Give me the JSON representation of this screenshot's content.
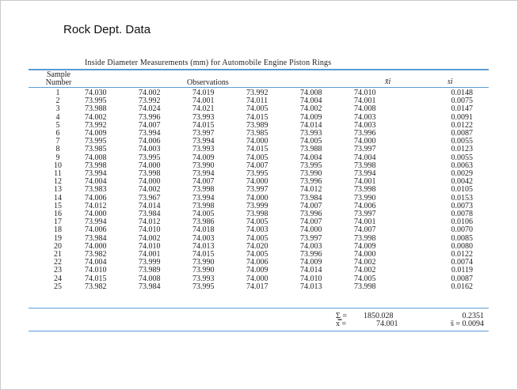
{
  "doc_title": "Rock Dept. Data",
  "caption": "Inside Diameter Measurements (mm) for Automobile Engine Piston Rings",
  "headers": {
    "sample_line1": "Sample",
    "sample_line2": "Number",
    "observations": "Observations",
    "xbar": "x̄i",
    "s": "si"
  },
  "rows": [
    [
      "1",
      "74.030",
      "74.002",
      "74.019",
      "73.992",
      "74.008",
      "74.010",
      "0.0148"
    ],
    [
      "2",
      "73.995",
      "73.992",
      "74.001",
      "74.011",
      "74.004",
      "74.001",
      "0.0075"
    ],
    [
      "3",
      "73.988",
      "74.024",
      "74.021",
      "74.005",
      "74.002",
      "74.008",
      "0.0147"
    ],
    [
      "4",
      "74.002",
      "73.996",
      "73.993",
      "74.015",
      "74.009",
      "74.003",
      "0.0091"
    ],
    [
      "5",
      "73.992",
      "74.007",
      "74.015",
      "73.989",
      "74.014",
      "74.003",
      "0.0122"
    ],
    [
      "6",
      "74.009",
      "73.994",
      "73.997",
      "73.985",
      "73.993",
      "73.996",
      "0.0087"
    ],
    [
      "7",
      "73.995",
      "74.006",
      "73.994",
      "74.000",
      "74.005",
      "74.000",
      "0.0055"
    ],
    [
      "8",
      "73.985",
      "74.003",
      "73.993",
      "74.015",
      "73.988",
      "73.997",
      "0.0123"
    ],
    [
      "9",
      "74.008",
      "73.995",
      "74.009",
      "74.005",
      "74.004",
      "74.004",
      "0.0055"
    ],
    [
      "10",
      "73.998",
      "74.000",
      "73.990",
      "74.007",
      "73.995",
      "73.998",
      "0.0063"
    ],
    [
      "11",
      "73.994",
      "73.998",
      "73.994",
      "73.995",
      "73.990",
      "73.994",
      "0.0029"
    ],
    [
      "12",
      "74.004",
      "74.000",
      "74.007",
      "74.000",
      "73.996",
      "74.001",
      "0.0042"
    ],
    [
      "13",
      "73.983",
      "74.002",
      "73.998",
      "73.997",
      "74.012",
      "73.998",
      "0.0105"
    ],
    [
      "14",
      "74.006",
      "73.967",
      "73.994",
      "74.000",
      "73.984",
      "73.990",
      "0.0153"
    ],
    [
      "15",
      "74.012",
      "74.014",
      "73.998",
      "73.999",
      "74.007",
      "74.006",
      "0.0073"
    ],
    [
      "16",
      "74.000",
      "73.984",
      "74.005",
      "73.998",
      "73.996",
      "73.997",
      "0.0078"
    ],
    [
      "17",
      "73.994",
      "74.012",
      "73.986",
      "74.005",
      "74.007",
      "74.001",
      "0.0106"
    ],
    [
      "18",
      "74.006",
      "74.010",
      "74.018",
      "74.003",
      "74.000",
      "74.007",
      "0.0070"
    ],
    [
      "19",
      "73.984",
      "74.002",
      "74.003",
      "74.005",
      "73.997",
      "73.998",
      "0.0085"
    ],
    [
      "20",
      "74.000",
      "74.010",
      "74.013",
      "74.020",
      "74.003",
      "74.009",
      "0.0080"
    ],
    [
      "21",
      "73.982",
      "74.001",
      "74.015",
      "74.005",
      "73.996",
      "74.000",
      "0.0122"
    ],
    [
      "22",
      "74.004",
      "73.999",
      "73.990",
      "74.006",
      "74.009",
      "74.002",
      "0.0074"
    ],
    [
      "23",
      "74.010",
      "73.989",
      "73.990",
      "74.009",
      "74.014",
      "74.002",
      "0.0119"
    ],
    [
      "24",
      "74.015",
      "74.008",
      "73.993",
      "74.000",
      "74.010",
      "74.005",
      "0.0087"
    ],
    [
      "25",
      "73.982",
      "73.984",
      "73.995",
      "74.017",
      "74.013",
      "73.998",
      "0.0162"
    ]
  ],
  "summary": {
    "sum_symbol": "Σ =",
    "sum_xbar": "1850.028",
    "sum_s": "0.2351",
    "mean_symbol": "x̿ =",
    "grand_mean": "74.001",
    "mean_s": "s̄ = 0.0094"
  },
  "colors": {
    "rule": "#5b9bd5"
  }
}
